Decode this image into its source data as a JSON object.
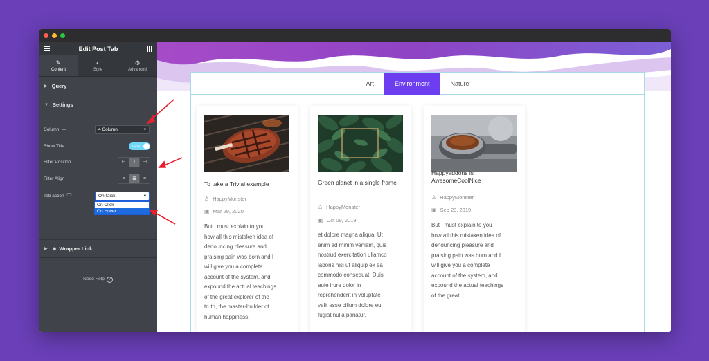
{
  "sidebar": {
    "title": "Edit Post Tab",
    "tabs": [
      {
        "label": "Content",
        "icon": "pencil-icon"
      },
      {
        "label": "Style",
        "icon": "half-circle-icon"
      },
      {
        "label": "Advanced",
        "icon": "gear-icon"
      }
    ],
    "sections": {
      "query": "Query",
      "settings": "Settings",
      "wrapper_link": "Wrapper Link"
    },
    "controls": {
      "column_label": "Column",
      "column_value": "4 Column",
      "show_title_label": "Show Title",
      "show_title_toggle": "SHOW",
      "filter_position_label": "Filter Position",
      "filter_align_label": "Filter Align",
      "tab_action_label": "Tab action",
      "tab_action_value": "On Click",
      "tab_action_options": [
        "On Click",
        "On Hover"
      ]
    },
    "need_help": "Need Help"
  },
  "colors": {
    "background": "#6a3fb8",
    "accent": "#6c3ef0",
    "toggle": "#71d7f7",
    "sidebar": "#404349"
  },
  "tabs": [
    "Art",
    "Environment",
    "Nature"
  ],
  "active_tab": "Environment",
  "posts": [
    {
      "title": "To take a Trivial example",
      "author": "HappyMonster",
      "date": "Mar 29, 2020",
      "body_lines": [
        "But I must explain to you",
        "how all this mistaken idea of",
        "denouncing pleasure and",
        "praising pain was born and I",
        "will give you a complete",
        "account of the system, and",
        "expound the actual teachings",
        "of the great explorer of the",
        "truth, the master-builder of",
        "human happiness."
      ]
    },
    {
      "title": "Green planet in a single frame",
      "author": "HappyMonster",
      "date": "Oct 09, 2019",
      "body_lines": [
        "et dolore magna aliqua. Ut",
        "enim ad minim veniam, quis",
        "nostrud exercitation ullamco",
        "laboris nisi ut aliquip ex ea",
        "commodo consequat. Duis",
        "aute irure dolor in",
        "reprehenderit in voluptate",
        "velit esse cillum dolore eu",
        "fugiat nulla pariatur."
      ]
    },
    {
      "title": "Happyaddons is AwesomeCoolNice",
      "author": "HappyMonster",
      "date": "Sep 23, 2019",
      "body_lines": [
        "But I must explain to you",
        "how all this mistaken idea of",
        "denouncing pleasure and",
        "praising pain was born and I",
        "will give you a complete",
        "account of the system, and",
        "expound the actual teachings",
        "of the great"
      ]
    }
  ]
}
